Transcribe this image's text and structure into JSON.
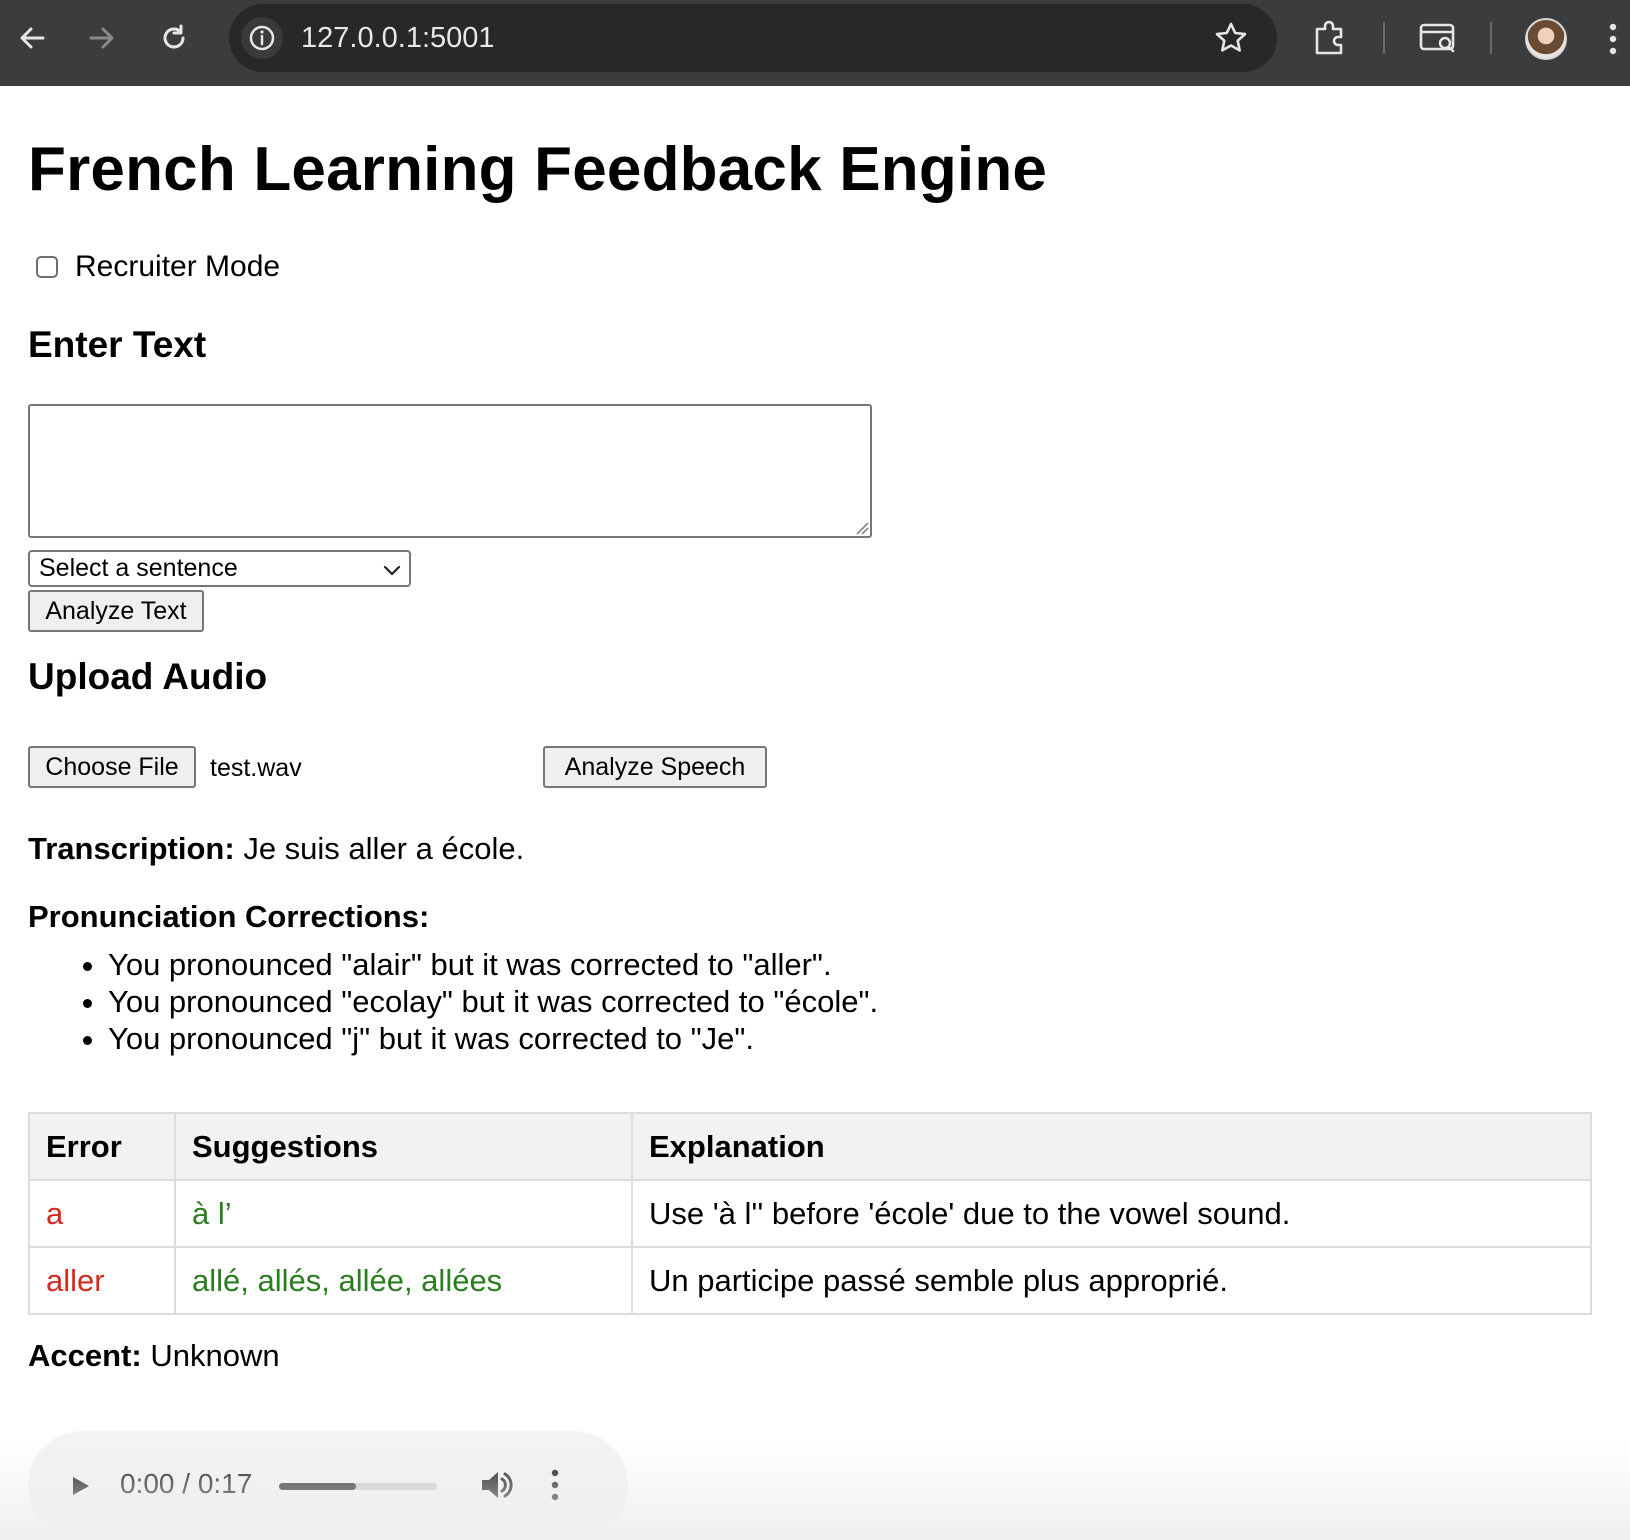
{
  "browser": {
    "url": "127.0.0.1:5001",
    "icons": [
      "back-arrow-icon",
      "forward-arrow-icon",
      "reload-icon",
      "site-info-icon",
      "bookmark-star-icon",
      "extensions-icon",
      "tab-search-icon",
      "profile-avatar",
      "browser-menu-icon"
    ]
  },
  "page": {
    "title": "French Learning Feedback Engine",
    "recruiter_mode_label": "Recruiter Mode",
    "recruiter_mode_checked": false
  },
  "text_section": {
    "heading": "Enter Text",
    "textarea_value": "",
    "select_value": "Select a sentence",
    "analyze_button": "Analyze Text"
  },
  "audio_section": {
    "heading": "Upload Audio",
    "choose_file_button": "Choose File",
    "file_name": "test.wav",
    "analyze_button": "Analyze Speech"
  },
  "results": {
    "transcription_label": "Transcription:",
    "transcription_value": "Je suis aller a école.",
    "corrections_heading": "Pronunciation Corrections:",
    "corrections": [
      "You pronounced \"alair\" but it was corrected to \"aller\".",
      "You pronounced \"ecolay\" but it was corrected to \"école\".",
      "You pronounced \"j\" but it was corrected to \"Je\"."
    ],
    "table": {
      "headers": [
        "Error",
        "Suggestions",
        "Explanation"
      ],
      "rows": [
        {
          "error": "a",
          "suggestions": "à l’",
          "explanation": "Use 'à l'' before 'école' due to the vowel sound."
        },
        {
          "error": "aller",
          "suggestions": "allé, allés, allée, allées",
          "explanation": "Un participe passé semble plus approprié."
        }
      ]
    },
    "accent_label": "Accent:",
    "accent_value": "Unknown"
  },
  "audio_player": {
    "time_display": "0:00 / 0:17",
    "progress_fraction": 0.49,
    "icons": [
      "play-icon",
      "volume-icon",
      "more-options-icon"
    ]
  },
  "colors": {
    "error": "#d42a1f",
    "suggestion": "#2a7d1f",
    "chrome_bg": "#3c3c3c",
    "table_header_bg": "#f2f2f2"
  }
}
